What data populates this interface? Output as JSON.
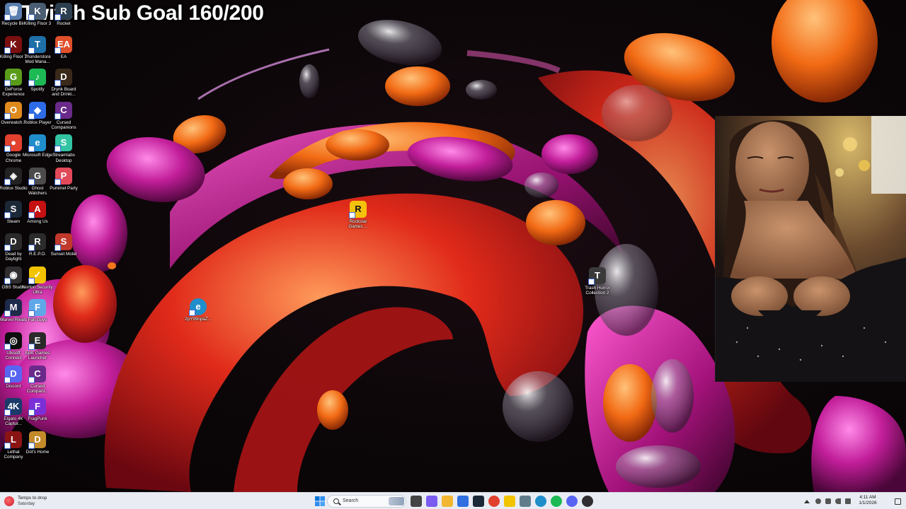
{
  "overlay": {
    "sub_goal_text": "Twitch Sub Goal 160/200"
  },
  "desktop_icons": [
    {
      "label": "Recycle Bin",
      "color": "#5a7fae",
      "glyph": "🗑"
    },
    {
      "label": "Killing Floor 3",
      "color": "#4a5d73",
      "glyph": "K"
    },
    {
      "label": "Rocket",
      "color": "#2c3e50",
      "glyph": "R"
    },
    {
      "label": "Killing Floor 2",
      "color": "#7a1010",
      "glyph": "K"
    },
    {
      "label": "Thunderstore Mod Mana...",
      "color": "#1f6fa8",
      "glyph": "T"
    },
    {
      "label": "EA",
      "color": "#e0502a",
      "glyph": "EA"
    },
    {
      "label": "GeForce Experience",
      "color": "#5a9c1a",
      "glyph": "G"
    },
    {
      "label": "Spotify",
      "color": "#1db954",
      "glyph": "♪"
    },
    {
      "label": "Drynk Board and Drinki...",
      "color": "#3b2a1a",
      "glyph": "D"
    },
    {
      "label": "Overwatch...",
      "color": "#e08a1e",
      "glyph": "O"
    },
    {
      "label": "Roblox Player",
      "color": "#2e6be6",
      "glyph": "◆"
    },
    {
      "label": "Cursed Companions",
      "color": "#6a2a8a",
      "glyph": "C"
    },
    {
      "label": "Google Chrome",
      "color": "#e2412f",
      "glyph": "●"
    },
    {
      "label": "Microsoft Edge",
      "color": "#1f8ecb",
      "glyph": "e"
    },
    {
      "label": "Streamlabs Desktop",
      "color": "#31c3a2",
      "glyph": "S"
    },
    {
      "label": "Roblox Studio",
      "color": "#222222",
      "glyph": "◈"
    },
    {
      "label": "Ghost Watchers",
      "color": "#4b4b4b",
      "glyph": "G"
    },
    {
      "label": "Pummel Party",
      "color": "#e24a5a",
      "glyph": "P"
    },
    {
      "label": "Steam",
      "color": "#1b2838",
      "glyph": "S"
    },
    {
      "label": "Among Us",
      "color": "#c51111",
      "glyph": "A"
    },
    {
      "label": "",
      "color": "#00000000",
      "glyph": ""
    },
    {
      "label": "Dead by Daylight",
      "color": "#2a2a2a",
      "glyph": "D"
    },
    {
      "label": "R.E.P.O.",
      "color": "#2b2b2b",
      "glyph": "R"
    },
    {
      "label": "Sunset Motel",
      "color": "#c0392b",
      "glyph": "S"
    },
    {
      "label": "OBS Studio",
      "color": "#302e31",
      "glyph": "◉"
    },
    {
      "label": "Norton Security Ultra",
      "color": "#f2c400",
      "glyph": "✓"
    },
    {
      "label": "",
      "color": "#00000000",
      "glyph": ""
    },
    {
      "label": "Marvel Rivals",
      "color": "#1e2a4a",
      "glyph": "M"
    },
    {
      "label": "Fall Guys",
      "color": "#5fa8e8",
      "glyph": "F"
    },
    {
      "label": "",
      "color": "#00000000",
      "glyph": ""
    },
    {
      "label": "Ubisoft Connect",
      "color": "#0d0d0d",
      "glyph": "◎"
    },
    {
      "label": "Epic Games Launcher",
      "color": "#2a2a2a",
      "glyph": "E"
    },
    {
      "label": "",
      "color": "#00000000",
      "glyph": ""
    },
    {
      "label": "Discord",
      "color": "#5865f2",
      "glyph": "D"
    },
    {
      "label": "Cursed Compani...",
      "color": "#6a2a8a",
      "glyph": "C"
    },
    {
      "label": "",
      "color": "#00000000",
      "glyph": ""
    },
    {
      "label": "Elgato 4K Captur...",
      "color": "#1a3a6a",
      "glyph": "4K"
    },
    {
      "label": "FragPunk",
      "color": "#7b2fd6",
      "glyph": "F"
    },
    {
      "label": "",
      "color": "#00000000",
      "glyph": ""
    },
    {
      "label": "Lethal Company",
      "color": "#8a1414",
      "glyph": "L"
    },
    {
      "label": "Dot's Home",
      "color": "#c48a2a",
      "glyph": "D"
    }
  ],
  "floating_icons": [
    {
      "label": "Rockstar Games ...",
      "color": "#f4c20d",
      "glyph": "R"
    },
    {
      "label": "2pY99npaZ...",
      "color": "#1f8ecb",
      "glyph": "e"
    },
    {
      "label": "Trash Horror Collection 2",
      "color": "#3a3a3a",
      "glyph": "T"
    }
  ],
  "taskbar": {
    "weather_title": "Temps to drop",
    "weather_sub": "Saturday",
    "search_placeholder": "Search",
    "clock_time": "4:11 AM",
    "clock_date": "1/1/2026",
    "pinned_apps": [
      {
        "name": "task-view",
        "color": "#444"
      },
      {
        "name": "copilot",
        "color": "#7a5cf0"
      },
      {
        "name": "file-explorer",
        "color": "#f2b632"
      },
      {
        "name": "store",
        "color": "#2f6fe0"
      },
      {
        "name": "steam",
        "color": "#1b2838"
      },
      {
        "name": "chrome",
        "color": "#e2412f"
      },
      {
        "name": "notes",
        "color": "#f2c400"
      },
      {
        "name": "document",
        "color": "#607d8b"
      },
      {
        "name": "edge",
        "color": "#1f8ecb"
      },
      {
        "name": "spotify",
        "color": "#1db954"
      },
      {
        "name": "discord",
        "color": "#5865f2"
      },
      {
        "name": "obs",
        "color": "#302e31"
      }
    ]
  },
  "colors": {
    "taskbar_bg": "#e9edf3",
    "accent": "#0067c0"
  }
}
